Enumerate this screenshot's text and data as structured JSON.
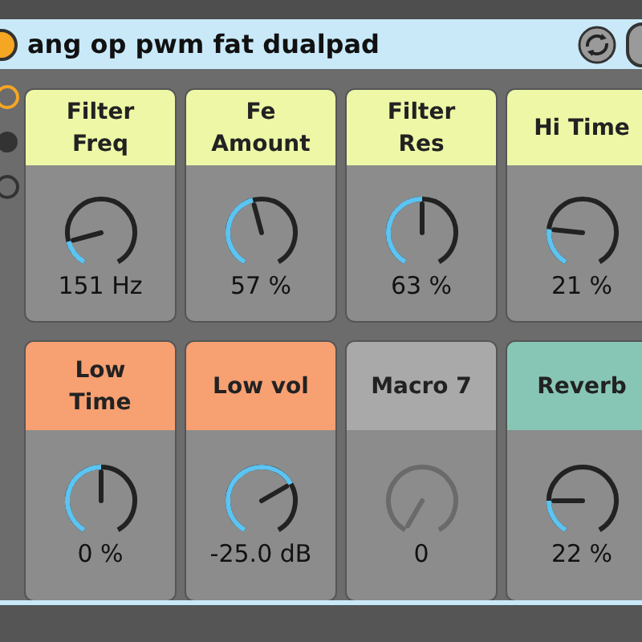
{
  "rack": {
    "title": "ang op pwm fat dualpad"
  },
  "macros": [
    {
      "name": "Filter\nFreq",
      "value": "151 Hz",
      "color": "#eef7a6",
      "disabled": false
    },
    {
      "name": "Fe\nAmount",
      "value": "57 %",
      "color": "#eef7a6",
      "disabled": false
    },
    {
      "name": "Filter\nRes",
      "value": "63 %",
      "color": "#eef7a6",
      "disabled": false
    },
    {
      "name": "Hi Time",
      "value": "21 %",
      "color": "#eef7a6",
      "disabled": false
    },
    {
      "name": "Low\nTime",
      "value": "0 %",
      "color": "#f7a072",
      "disabled": false
    },
    {
      "name": "Low vol",
      "value": "-25.0 dB",
      "color": "#f7a072",
      "disabled": false
    },
    {
      "name": "Macro 7",
      "value": "0",
      "color": "#a9a9a9",
      "disabled": true
    },
    {
      "name": "Reverb",
      "value": "22 %",
      "color": "#87c6b5",
      "disabled": false
    }
  ]
}
